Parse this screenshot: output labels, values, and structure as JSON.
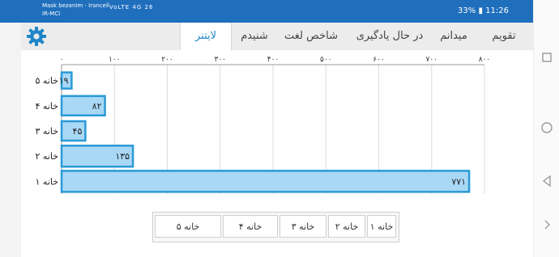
{
  "status_bar": {
    "carrier_line1": "Mask bezanim - Irancell",
    "carrier_line2": "IR-MCI",
    "icons": "VoLTE 4G 26",
    "battery": "33%",
    "time": "11:26"
  },
  "header": {
    "settings_icon": "gear-icon",
    "tabs": [
      {
        "label": "تقویم"
      },
      {
        "label": "میدانم"
      },
      {
        "label": "در حال یادگیری"
      },
      {
        "label": "شاخص لغت"
      },
      {
        "label": "شنیدم"
      },
      {
        "label": "لایتنر"
      }
    ],
    "active_tab": "لایتنر"
  },
  "chart_data": {
    "type": "bar",
    "orientation": "horizontal",
    "categories": [
      "خانه ۵",
      "خانه ۴",
      "خانه ۳",
      "خانه ۲",
      "خانه ۱"
    ],
    "values": [
      19,
      82,
      45,
      135,
      771
    ],
    "value_labels": [
      "۱۹",
      "۸۲",
      "۴۵",
      "۱۳۵",
      "۷۷۱"
    ],
    "x_ticks": [
      0,
      100,
      200,
      300,
      400,
      500,
      600,
      700,
      800
    ],
    "x_tick_labels": [
      "۰",
      "۱۰۰",
      "۲۰۰",
      "۳۰۰",
      "۴۰۰",
      "۵۰۰",
      "۶۰۰",
      "۷۰۰",
      "۸۰۰"
    ],
    "xlim": [
      0,
      800
    ],
    "x_axis_position": "top",
    "grid": true,
    "bar_fill": "#a9d8f6",
    "bar_stroke": "#2a9ad6"
  },
  "legend": {
    "buttons": [
      "خانه ۵",
      "خانه ۴",
      "خانه ۳",
      "خانه ۲",
      "خانه ۱"
    ]
  },
  "nav_bar": {
    "icons": [
      "circle-home-icon",
      "triangle-back-icon",
      "chevron-right-icon"
    ]
  },
  "colors": {
    "status_bar": "#1f6fbd",
    "accent": "#1f86c9",
    "header_bg": "#ececec"
  }
}
